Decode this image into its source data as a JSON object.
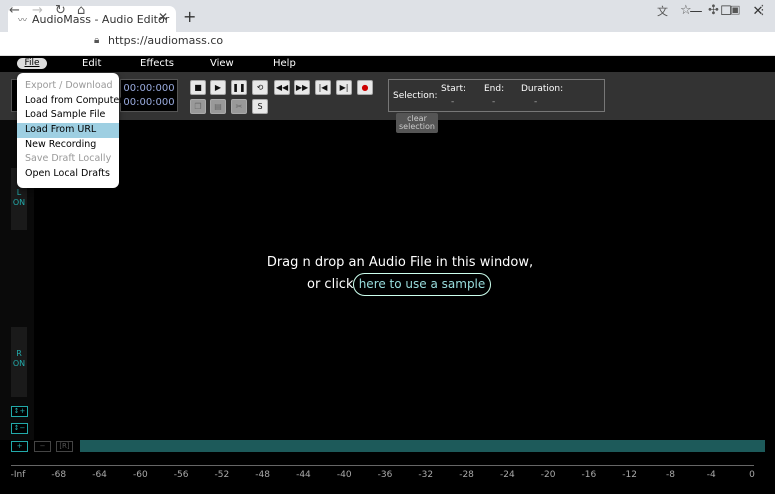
{
  "browser": {
    "tab_title": "AudioMass - Audio Editor",
    "url": "https://audiomass.co",
    "new_tab": "+",
    "min": "—",
    "max": "☐",
    "close": "✕"
  },
  "menubar": {
    "file": "File",
    "edit": "Edit",
    "effects": "Effects",
    "view": "View",
    "help": "Help"
  },
  "file_menu": {
    "items": [
      "Export / Download",
      "Load from Computer",
      "Load Sample File",
      "Load From URL",
      "New Recording",
      "Save Draft Locally",
      "Open Local Drafts"
    ],
    "disabled": [
      "Export / Download",
      "Save Draft Locally"
    ],
    "highlighted": "Load From URL"
  },
  "time": {
    "current": "00:00:000",
    "total": "00:00:000"
  },
  "transport": {
    "s_label": "S"
  },
  "selection": {
    "label": "Selection:",
    "start_label": "Start:",
    "end_label": "End:",
    "duration_label": "Duration:",
    "start": "-",
    "end": "-",
    "duration": "-",
    "clear": "clear selection"
  },
  "channels": {
    "left": "L",
    "left_state": "ON",
    "right": "R",
    "right_state": "ON"
  },
  "drop": {
    "line1": "Drag n drop an Audio File in this window,",
    "or_click": "or click",
    "sample_link": "here to use a sample"
  },
  "zoom": {
    "plus": "+",
    "minus": "−",
    "reset": "[R]",
    "vplus": "↕+",
    "vminus": "↕−"
  },
  "ruler": [
    "-Inf",
    "-68",
    "-64",
    "-60",
    "-56",
    "-52",
    "-48",
    "-44",
    "-40",
    "-36",
    "-32",
    "-28",
    "-24",
    "-20",
    "-16",
    "-12",
    "-8",
    "-4",
    "0"
  ],
  "colors": {
    "accent": "#2aa",
    "highlight": "#9ecfe2",
    "scroll": "#1d5a5a",
    "record": "#c00"
  }
}
